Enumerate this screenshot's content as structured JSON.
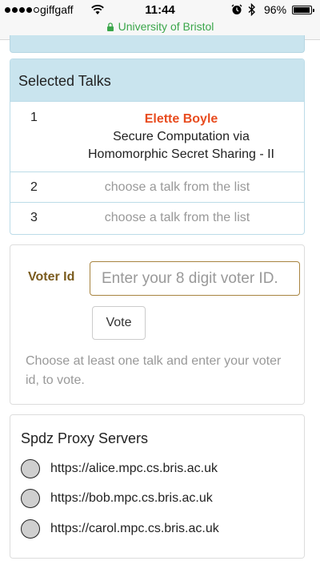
{
  "status_bar": {
    "carrier": "giffgaff",
    "time": "11:44",
    "battery": "96%",
    "battery_level": 0.96,
    "url": "University of Bristol",
    "signal_bars_on": 4,
    "signal_bars_total": 5
  },
  "selected_talks": {
    "heading": "Selected Talks",
    "rows": [
      {
        "num": "1",
        "speaker": "Elette Boyle",
        "title_line1": "Secure Computation via",
        "title_line2": "Homomorphic Secret Sharing - II"
      },
      {
        "num": "2",
        "placeholder": "choose a talk from the list"
      },
      {
        "num": "3",
        "placeholder": "choose a talk from the list"
      }
    ]
  },
  "vote": {
    "label": "Voter Id",
    "input_placeholder": "Enter your 8 digit voter ID.",
    "input_value": "",
    "button_label": "Vote",
    "help_text": "Choose at least one talk and enter your voter id, to vote."
  },
  "servers": {
    "title": "Spdz Proxy Servers",
    "items": [
      {
        "address": "https://alice.mpc.cs.bris.ac.uk"
      },
      {
        "address": "https://bob.mpc.cs.bris.ac.uk"
      },
      {
        "address": "https://carol.mpc.cs.bris.ac.uk"
      }
    ]
  },
  "colors": {
    "panel_heading_bg": "#c9e4ee",
    "speaker": "#e84c1f",
    "label": "#7a5b1e",
    "url": "#3aa64a"
  }
}
